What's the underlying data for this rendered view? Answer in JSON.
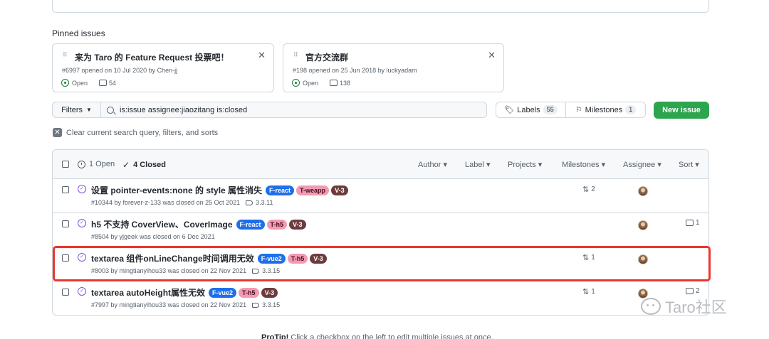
{
  "pinned": {
    "title": "Pinned issues",
    "cards": [
      {
        "title": "来为 Taro 的 Feature Request 投票吧！",
        "meta": "#6997 opened on 10 Jul 2020 by Chen-jj",
        "status": "Open",
        "comments": "54"
      },
      {
        "title": "官方交流群",
        "meta": "#198 opened on 25 Jun 2018 by luckyadam",
        "status": "Open",
        "comments": "138"
      }
    ]
  },
  "toolbar": {
    "filters_label": "Filters",
    "search_value": "is:issue assignee:jiaozitang is:closed",
    "labels_label": "Labels",
    "labels_count": "55",
    "milestones_label": "Milestones",
    "milestones_count": "1",
    "new_issue_label": "New issue"
  },
  "clear_text": "Clear current search query, filters, and sorts",
  "list_header": {
    "open": "1 Open",
    "closed": "4 Closed",
    "filters": [
      "Author",
      "Label",
      "Projects",
      "Milestones",
      "Assignee",
      "Sort"
    ]
  },
  "issues": [
    {
      "title": "设置 pointer-events:none 的 style 属性消失",
      "labels": [
        {
          "text": "F-react",
          "bg": "#1f6feb",
          "fg": "#ffffff"
        },
        {
          "text": "T-weapp",
          "bg": "#f29ab2",
          "fg": "#4a0e22"
        },
        {
          "text": "V-3",
          "bg": "#6e3b3b",
          "fg": "#ffffff"
        }
      ],
      "meta": "#10344 by forever-z-133 was closed on 25 Oct 2021",
      "milestone": "3.3.11",
      "pr_count": "2",
      "comments": ""
    },
    {
      "title": "h5 不支持 CoverView、CoverImage",
      "labels": [
        {
          "text": "F-react",
          "bg": "#1f6feb",
          "fg": "#ffffff"
        },
        {
          "text": "T-h5",
          "bg": "#f29ab2",
          "fg": "#4a0e22"
        },
        {
          "text": "V-3",
          "bg": "#6e3b3b",
          "fg": "#ffffff"
        }
      ],
      "meta": "#8504 by yjgeek was closed on 6 Dec 2021",
      "milestone": "",
      "pr_count": "",
      "comments": "1"
    },
    {
      "title": "textarea 组件onLineChange时间调用无效",
      "labels": [
        {
          "text": "F-vue2",
          "bg": "#1f6feb",
          "fg": "#ffffff"
        },
        {
          "text": "T-h5",
          "bg": "#f29ab2",
          "fg": "#4a0e22"
        },
        {
          "text": "V-3",
          "bg": "#6e3b3b",
          "fg": "#ffffff"
        }
      ],
      "meta": "#8003 by mingtianyihou33 was closed on 22 Nov 2021",
      "milestone": "3.3.15",
      "pr_count": "1",
      "comments": ""
    },
    {
      "title": "textarea autoHeight属性无效",
      "labels": [
        {
          "text": "F-vue2",
          "bg": "#1f6feb",
          "fg": "#ffffff"
        },
        {
          "text": "T-h5",
          "bg": "#f29ab2",
          "fg": "#4a0e22"
        },
        {
          "text": "V-3",
          "bg": "#6e3b3b",
          "fg": "#ffffff"
        }
      ],
      "meta": "#7997 by mingtianyihou33 was closed on 22 Nov 2021",
      "milestone": "3.3.15",
      "pr_count": "1",
      "comments": "2"
    }
  ],
  "protip": {
    "bold": "ProTip!",
    "text": " Click a checkbox on the left to edit multiple issues at once."
  },
  "watermark": "Taro社区",
  "colors": {
    "accent_green": "#2da44e",
    "highlight_red": "#e8372e",
    "closed_purple": "#8250df"
  }
}
